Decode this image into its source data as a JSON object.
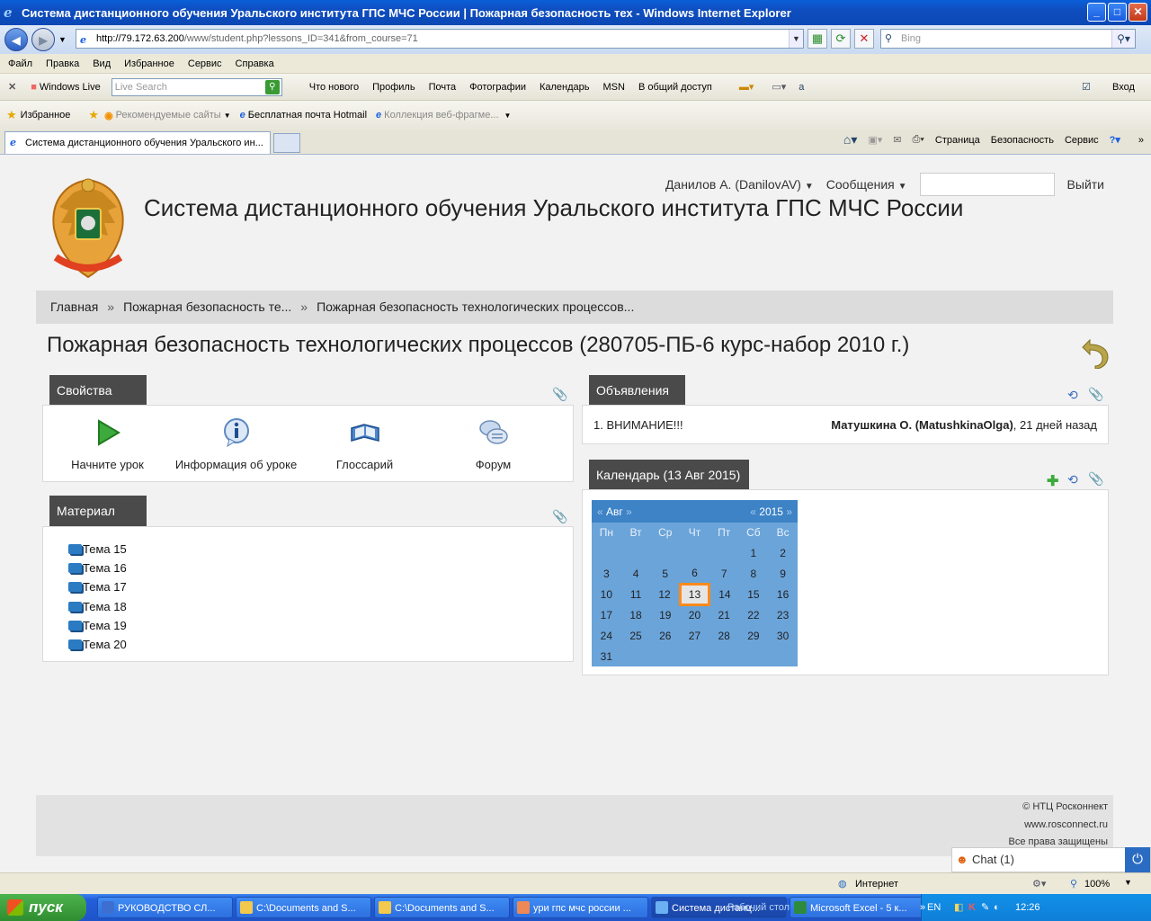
{
  "window": {
    "title": "Система дистанционного обучения Уральского института ГПС МЧС России | Пожарная безопасность тех - Windows Internet Explorer"
  },
  "address": {
    "host": "http://79.172.63.200",
    "path": "/www/student.php?lessons_ID=341&from_course=71",
    "search_placeholder": "Bing"
  },
  "menu": [
    "Файл",
    "Правка",
    "Вид",
    "Избранное",
    "Сервис",
    "Справка"
  ],
  "livebar": {
    "brand": "Windows Live",
    "search_placeholder": "Live Search",
    "links": [
      "Что нового",
      "Профиль",
      "Почта",
      "Фотографии",
      "Календарь",
      "MSN",
      "В общий доступ"
    ],
    "signin": "Вход"
  },
  "favbar": {
    "favorites": "Избранное",
    "items": [
      "Рекомендуемые сайты",
      "Бесплатная почта Hotmail",
      "Коллекция веб-фрагме..."
    ]
  },
  "tab": {
    "title": "Система дистанционного обучения Уральского ин..."
  },
  "commands": [
    "Страница",
    "Безопасность",
    "Сервис"
  ],
  "page": {
    "user": "Данилов А. (DanilovAV)",
    "messages": "Сообщения",
    "logout": "Выйти",
    "site_title": "Система дистанционного обучения Уральского института ГПС МЧС России",
    "breadcrumbs": [
      "Главная",
      "Пожарная безопасность те...",
      "Пожарная безопасность технологических процессов..."
    ],
    "breadcrumb_sep": "»",
    "title": "Пожарная безопасность технологических процессов (280705-ПБ-6 курс-набор 2010 г.)",
    "props": {
      "header": "Свойства",
      "items": [
        "Начните урок",
        "Информация об уроке",
        "Глоссарий",
        "Форум"
      ]
    },
    "materials": {
      "header": "Материал",
      "items": [
        "Тема 15",
        "Тема 16",
        "Тема 17",
        "Тема 18",
        "Тема 19",
        "Тема 20"
      ]
    },
    "announcements": {
      "header": "Объявления",
      "item": "1. ВНИМАНИЕ!!!",
      "author": "Матушкина О. (MatushkinaOlga)",
      "when": ", 21 дней назад"
    },
    "calendar": {
      "header": "Календарь (13 Авг 2015)",
      "month": "Авг",
      "year": "2015",
      "weekdays": [
        "Пн",
        "Вт",
        "Ср",
        "Чт",
        "Пт",
        "Сб",
        "Вс"
      ],
      "weeks": [
        [
          "",
          "",
          "",
          "",
          "",
          "1",
          "2"
        ],
        [
          "3",
          "4",
          "5",
          "6",
          "7",
          "8",
          "9"
        ],
        [
          "10",
          "11",
          "12",
          "13",
          "14",
          "15",
          "16"
        ],
        [
          "17",
          "18",
          "19",
          "20",
          "21",
          "22",
          "23"
        ],
        [
          "24",
          "25",
          "26",
          "27",
          "28",
          "29",
          "30"
        ],
        [
          "31",
          "",
          "",
          "",
          "",
          "",
          ""
        ]
      ],
      "today": "13"
    },
    "footer": [
      "© НТЦ Росконнект",
      "www.rosconnect.ru",
      "Все права защищены"
    ],
    "chat": "Chat (1)"
  },
  "status": {
    "zone": "Интернет",
    "zoom": "100%"
  },
  "taskbar": {
    "start": "пуск",
    "buttons": [
      "РУКОВОДСТВО СЛ...",
      "C:\\Documents and S...",
      "C:\\Documents and S...",
      "ури гпс мчс россии ...",
      "Система дистанц...",
      "Microsoft Excel - 5 к..."
    ],
    "desktop": "Рабочий стол",
    "lang": "EN",
    "time": "12:26"
  }
}
